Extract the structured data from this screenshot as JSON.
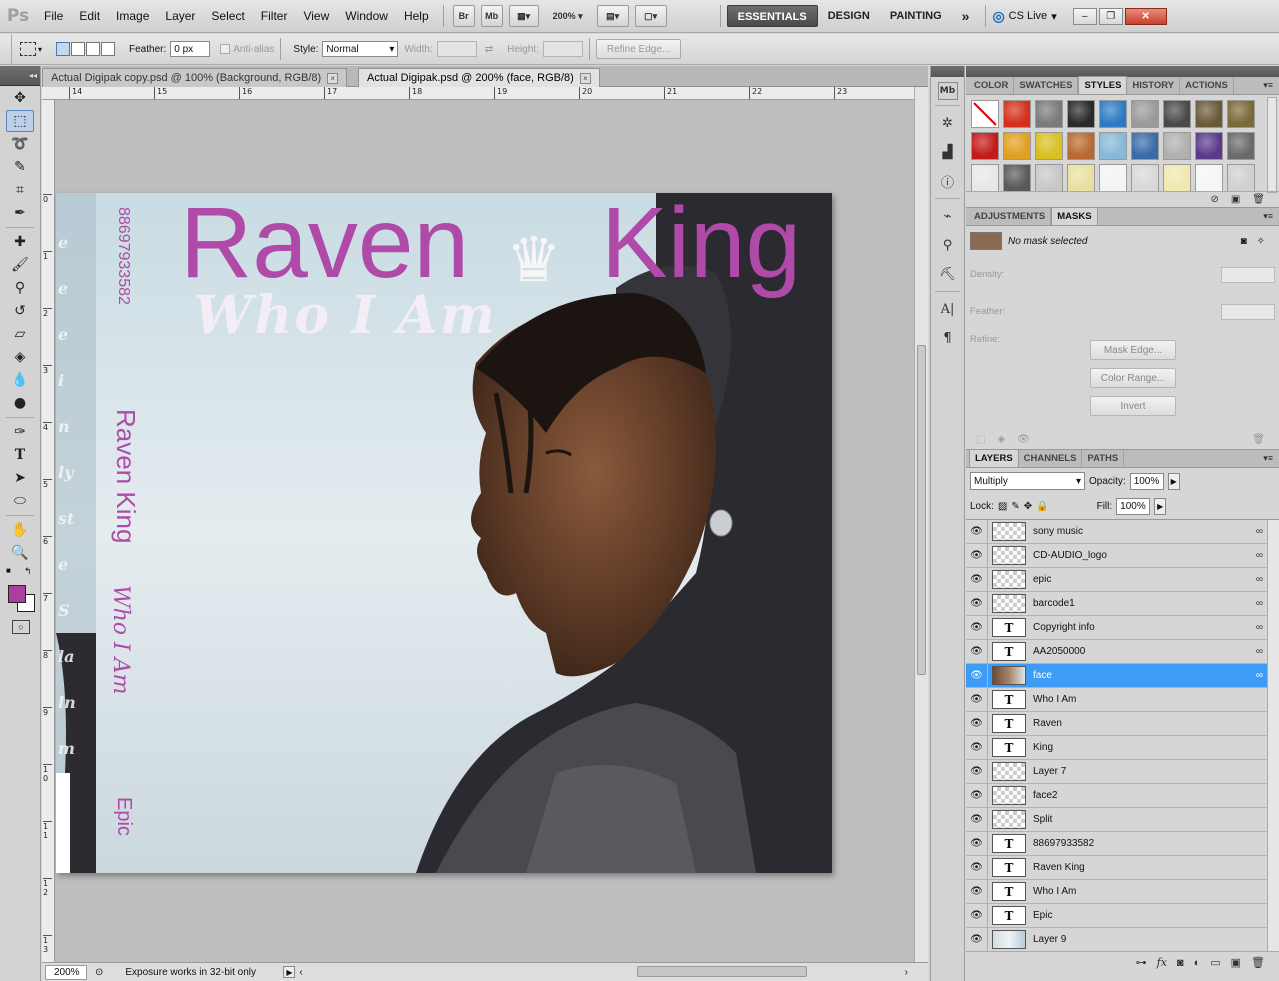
{
  "menubar": {
    "logo": "Ps",
    "items": [
      "File",
      "Edit",
      "Image",
      "Layer",
      "Select",
      "Filter",
      "View",
      "Window",
      "Help"
    ],
    "bridge_label": "Br",
    "minibridge_label": "Mb",
    "zoom": "200%",
    "workspaces": [
      "ESSENTIALS",
      "DESIGN",
      "PAINTING"
    ],
    "more": "»",
    "cslive": "CS Live"
  },
  "options": {
    "feather_label": "Feather:",
    "feather_value": "0 px",
    "antialias_label": "Anti-alias",
    "style_label": "Style:",
    "style_value": "Normal",
    "width_label": "Width:",
    "height_label": "Height:",
    "refine_edge": "Refine Edge..."
  },
  "tabs": [
    {
      "label": "Actual Digipak copy.psd @ 100% (Background, RGB/8)",
      "close": "×"
    },
    {
      "label": "Actual Digipak.psd @ 200% (face, RGB/8)",
      "close": "×"
    }
  ],
  "ruler": {
    "top": [
      "14",
      "15",
      "16",
      "17",
      "18",
      "19",
      "20",
      "21",
      "22",
      "23"
    ],
    "left": [
      "0",
      "1",
      "2",
      "3",
      "4",
      "5",
      "6",
      "7",
      "8",
      "9",
      "1 0",
      "1 1",
      "1 2",
      "1 3"
    ]
  },
  "artwork": {
    "title_left": "Raven",
    "title_right": "King",
    "script": "Who I Am",
    "spine_barcode": "88697933582",
    "spine_artist": "Raven King",
    "spine_album": "Who I Am",
    "spine_label": "Epic",
    "ghost_letters": [
      "e",
      "e",
      "e",
      "i",
      "n",
      "ly",
      "st",
      "e",
      "S",
      "la",
      "ln",
      "m"
    ]
  },
  "status": {
    "zoom": "200%",
    "info": "Exposure works in 32-bit only"
  },
  "panels": {
    "top_tabs": [
      "COLOR",
      "SWATCHES",
      "STYLES",
      "HISTORY",
      "ACTIONS"
    ],
    "active_top": "STYLES",
    "style_colors": [
      "#ffffff",
      "#d4301c",
      "#7a7a7a",
      "#2a2a2a",
      "#2d7bc4",
      "#9a9a9a",
      "#4a4a4a",
      "#6b5a3a",
      "#7a6a3a",
      "#c41a1a",
      "#e0a020",
      "#d8c020",
      "#b86a30",
      "#88b8d8",
      "#3a6aa8",
      "#b0b0b0",
      "#5a3a8a",
      "#6a6a6a",
      "#e8e8e8",
      "#5a5a5a",
      "#c8c8c8",
      "#e8e0a0",
      "#f4f4f4",
      "#d8d8d8",
      "#f0e8b0",
      "#f6f6f6",
      "#d0d0d0"
    ],
    "mid_tabs": [
      "ADJUSTMENTS",
      "MASKS"
    ],
    "active_mid": "MASKS",
    "mask_status": "No mask selected",
    "density_label": "Density:",
    "feather_label": "Feather:",
    "refine_label": "Refine:",
    "mask_edge": "Mask Edge...",
    "color_range": "Color Range...",
    "invert": "Invert",
    "layer_tabs": [
      "LAYERS",
      "CHANNELS",
      "PATHS"
    ],
    "active_layer_tab": "LAYERS",
    "blend_mode": "Multiply",
    "opacity_label": "Opacity:",
    "opacity_value": "100%",
    "lock_label": "Lock:",
    "fill_label": "Fill:",
    "fill_value": "100%",
    "layers": [
      {
        "name": "sony music",
        "thumb": "checker",
        "link": true
      },
      {
        "name": "CD-AUDIO_logo",
        "thumb": "checker",
        "link": true
      },
      {
        "name": "epic",
        "thumb": "checker",
        "link": true
      },
      {
        "name": "barcode1",
        "thumb": "checker",
        "link": true
      },
      {
        "name": "Copyright info",
        "thumb": "text",
        "link": true
      },
      {
        "name": "AA2050000",
        "thumb": "text",
        "link": true
      },
      {
        "name": "face",
        "thumb": "photo",
        "link": true,
        "selected": true
      },
      {
        "name": "Who I Am",
        "thumb": "text",
        "link": false
      },
      {
        "name": "Raven",
        "thumb": "text",
        "link": false
      },
      {
        "name": "King",
        "thumb": "text",
        "link": false
      },
      {
        "name": "Layer 7",
        "thumb": "checker",
        "link": false
      },
      {
        "name": "face2",
        "thumb": "checker",
        "link": false
      },
      {
        "name": "Split",
        "thumb": "checker",
        "link": false
      },
      {
        "name": "88697933582",
        "thumb": "text",
        "link": false
      },
      {
        "name": "Raven King",
        "thumb": "text",
        "link": false
      },
      {
        "name": "Who I Am",
        "thumb": "text",
        "link": false
      },
      {
        "name": "Epic",
        "thumb": "text",
        "link": false
      },
      {
        "name": "Layer 9",
        "thumb": "sky",
        "link": false
      }
    ],
    "text_glyph": "T",
    "link_glyph": "∞"
  }
}
